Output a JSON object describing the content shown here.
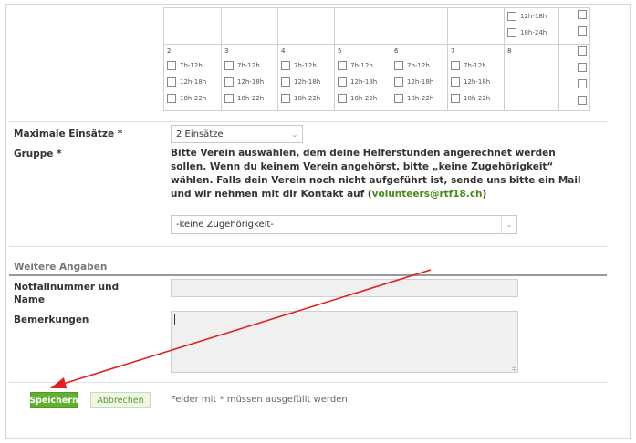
{
  "calendar": {
    "row1": {
      "last_cell_slots": [
        "12h-18h",
        "18h-24h"
      ]
    },
    "row2": {
      "days": [
        {
          "num": "2",
          "slots": [
            "7h-12h",
            "12h-18h",
            "18h-22h"
          ]
        },
        {
          "num": "3",
          "slots": [
            "7h-12h",
            "12h-18h",
            "18h-22h"
          ]
        },
        {
          "num": "4",
          "slots": [
            "7h-12h",
            "12h-18h",
            "18h-22h"
          ]
        },
        {
          "num": "5",
          "slots": [
            "7h-12h",
            "12h-18h",
            "18h-22h"
          ]
        },
        {
          "num": "6",
          "slots": [
            "7h-12h",
            "12h-18h",
            "18h-22h"
          ]
        },
        {
          "num": "7",
          "slots": [
            "7h-12h",
            "12h-18h",
            "18h-22h"
          ]
        },
        {
          "num": "8",
          "slots": []
        }
      ]
    }
  },
  "form": {
    "max_label": "Maximale Einsätze *",
    "max_value": "2 Einsätze",
    "group_label": "Gruppe *",
    "group_text": "Bitte Verein auswählen, dem deine Helferstunden angerechnet werden sollen. Wenn du keinem Verein angehörst, bitte „keine Zugehörigkeit“ wählen. Falls dein Verein noch nicht aufgeführt ist, sende uns bitte ein Mail und wir nehmen mit dir Kontakt auf (",
    "group_email": "volunteers@rtf18.ch",
    "group_text_end": ")",
    "group_value": "-keine Zugehörigkeit-",
    "section_title": "Weitere Angaben",
    "emergency_label": "Notfallnummer und Name",
    "emergency_value": "",
    "remarks_label": "Bemerkungen",
    "remarks_value": ""
  },
  "actions": {
    "save_label": "Speichern",
    "cancel_label": "Abbrechen",
    "required_note": "Felder mit * müssen ausgefüllt werden"
  },
  "colors": {
    "accent": "#62b030",
    "annotation_arrow": "#e02020"
  }
}
